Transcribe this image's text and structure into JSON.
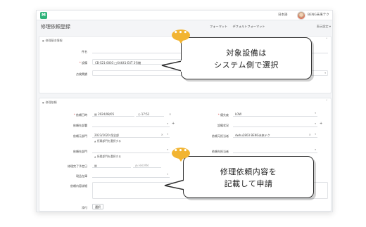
{
  "app": {
    "logo_text": "M",
    "language": "日本語",
    "user_name": "BENG未来テク"
  },
  "page": {
    "title": "修理依頼登録",
    "links": [
      "フォーマット",
      "デフォルトフォーマット",
      "表示設定"
    ]
  },
  "basic_section": {
    "title": "修理基本情報",
    "fields": [
      {
        "label": "件名",
        "value": ""
      },
      {
        "label": "設備",
        "required": true,
        "value": "CB-S21-0003 □XA641-E4T 3号機"
      },
      {
        "label": "点検実績",
        "value": ""
      }
    ]
  },
  "request_section": {
    "title": "修理依頼",
    "request_date_label": "依頼日時",
    "request_date": "2024/08/05",
    "request_time": "17:51",
    "priority_label": "優先度",
    "priority_value": "LOW",
    "dept_label": "依頼先部署",
    "dept_value": "",
    "facility_status_label": "設備状況",
    "facility_status_value": "",
    "req_dept_label": "依頼元部門",
    "req_dept_value": "2023/2020 保全部",
    "req_dept_link": "所属部門を選択する",
    "req_person_label": "依頼元担当者",
    "req_person_value": "dwhu2803 BENG未来テク",
    "req_to_label": "依頼先部門",
    "req_to_link": "所属部門を選択する",
    "req_to_person_label": "依頼先担当者",
    "desired_label": "修理完了予定日",
    "desired_time_ph": "HH:MM",
    "done_label": "修理完了日",
    "site_label": "現品在庫",
    "content_label": "依頼内容詳細",
    "attach_label": "添付",
    "select_button": "選択"
  },
  "callouts": {
    "top": {
      "dots": "•••",
      "lines": [
        "対象設備は",
        "システム側で選択"
      ]
    },
    "bottom": {
      "dots": "•••",
      "lines": [
        "修理依頼内容を",
        "記載して申請"
      ]
    }
  }
}
